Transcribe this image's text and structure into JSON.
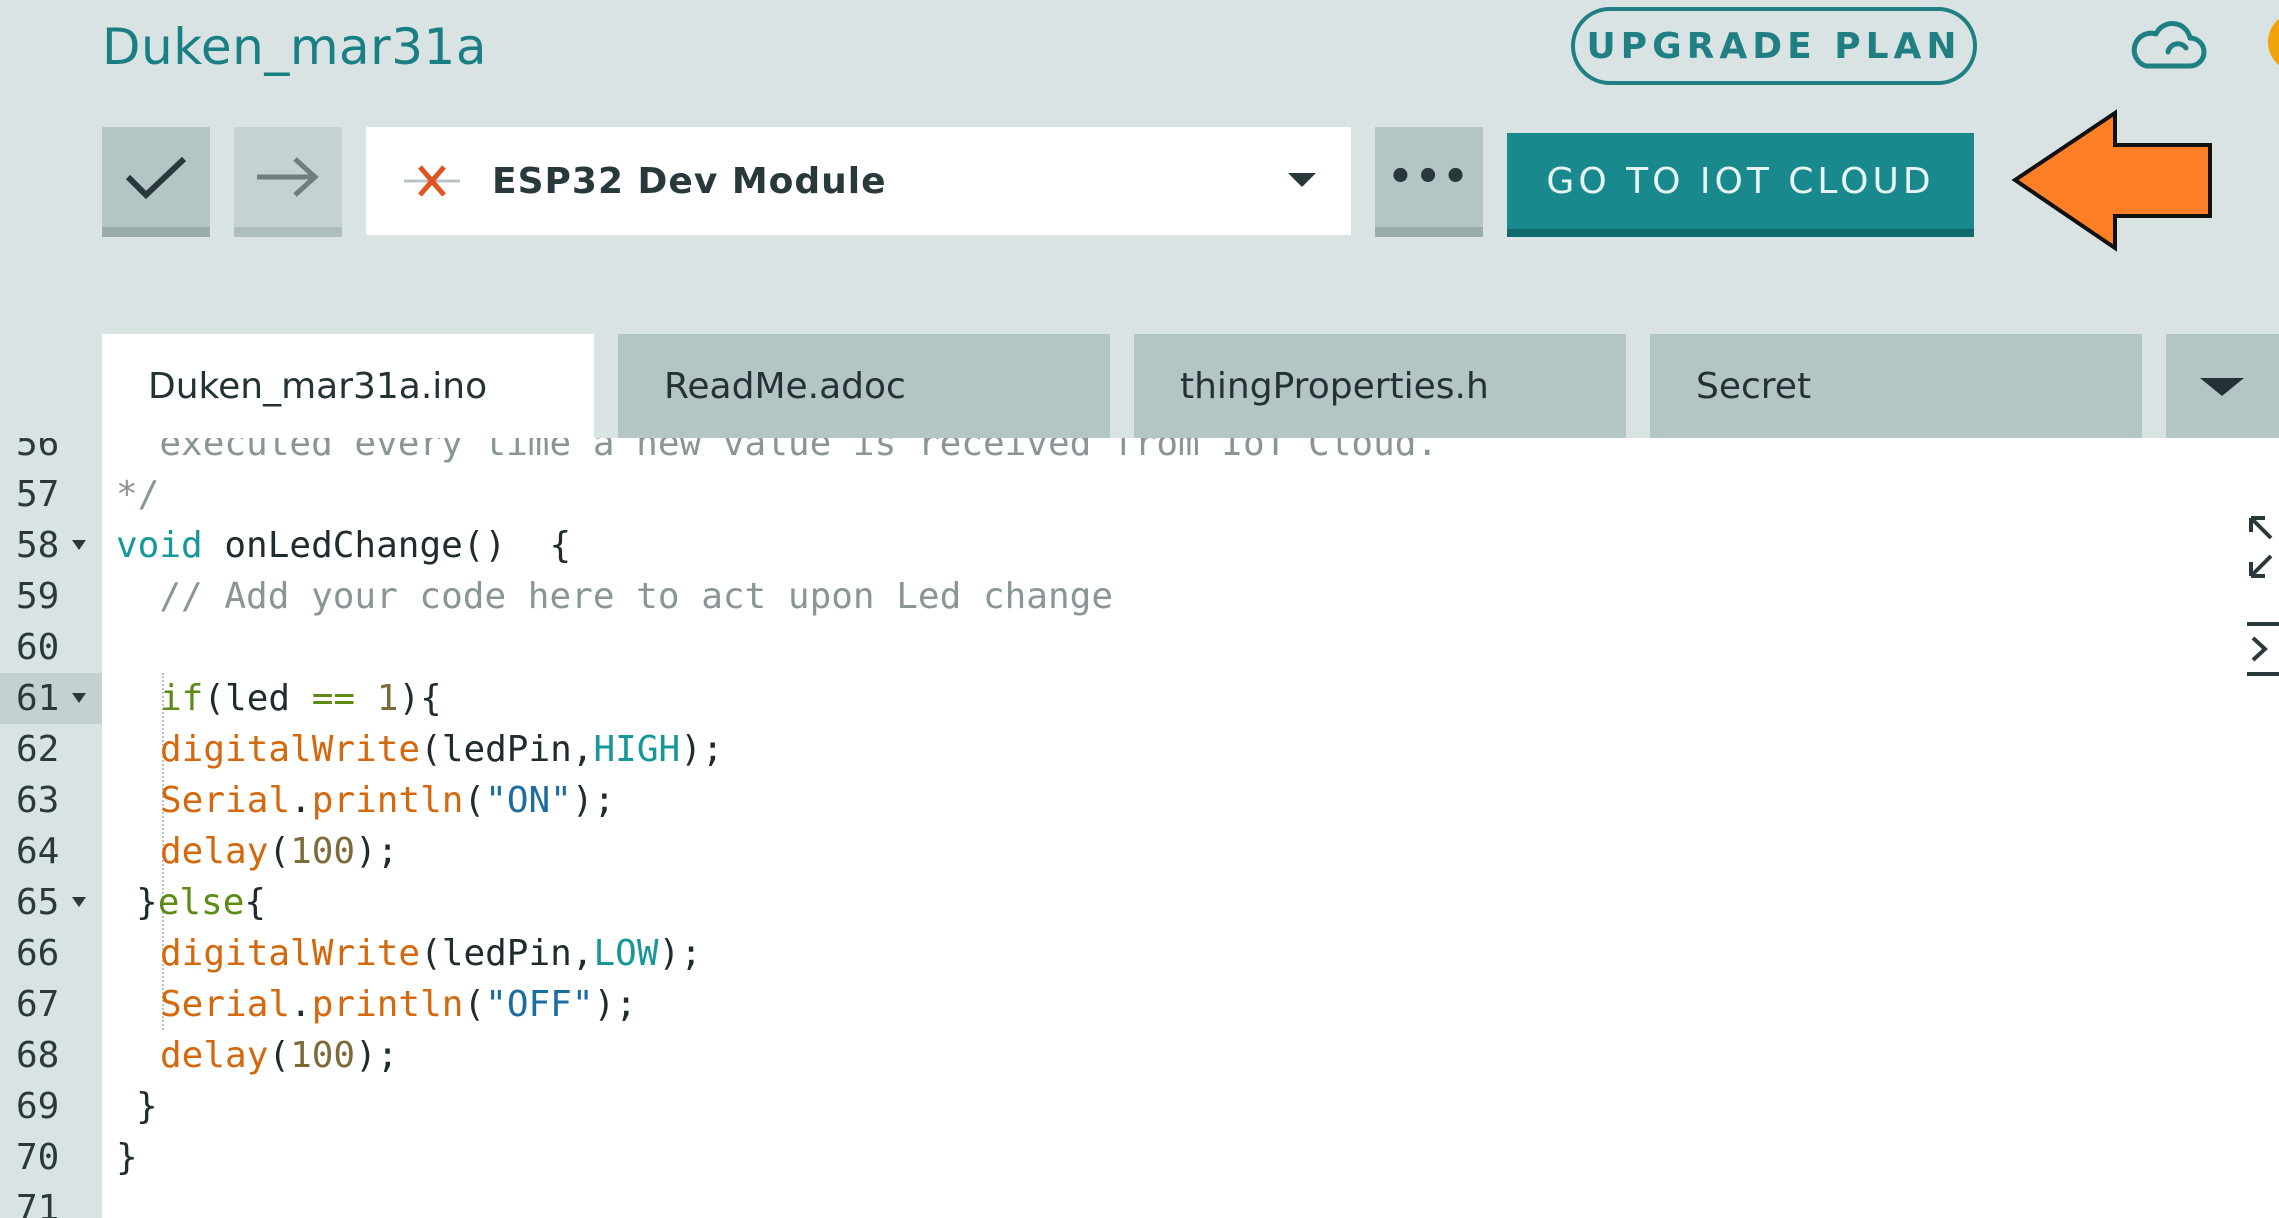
{
  "header": {
    "sketch_title": "Duken_mar31a",
    "upgrade_label": "UPGRADE PLAN"
  },
  "toolbar": {
    "board": "ESP32 Dev Module",
    "more_label": "•••",
    "iot_label": "GO TO IOT CLOUD"
  },
  "tabs": [
    {
      "label": "Duken_mar31a.ino",
      "active": true
    },
    {
      "label": "ReadMe.adoc",
      "active": false
    },
    {
      "label": "thingProperties.h",
      "active": false
    },
    {
      "label": "Secret",
      "active": false
    }
  ],
  "editor": {
    "active_line": 61,
    "line_numbers": [
      "56",
      "57",
      "58",
      "59",
      "60",
      "61",
      "62",
      "63",
      "64",
      "65",
      "66",
      "67",
      "68",
      "69",
      "70",
      "71"
    ],
    "code": {
      "l56": "  executed every time a new value is received from IoT Cloud.",
      "l57": "*/",
      "l58_kw": "void",
      "l58_rest": " onLedChange()  {",
      "l59": "  // Add your code here to act upon Led change",
      "l61_kw": "if",
      "l61_a": "(led ",
      "l61_op": "==",
      "l61_b": " ",
      "l61_num": "1",
      "l61_c": "){",
      "fn_digitalWrite": "digitalWrite",
      "arg_ledPin_open": "(ledPin,",
      "cst_high": "HIGH",
      "cst_low": "LOW",
      "close_paren_semi": ");",
      "fn_serial": "Serial",
      "dot": ".",
      "fn_println": "println",
      "open_paren": "(",
      "str_on": "\"ON\"",
      "str_off": "\"OFF\"",
      "fn_delay": "delay",
      "num_100": "100",
      "l65_brace": "}",
      "l65_kw": "else",
      "l65_open": "{",
      "l69": "}",
      "l70": "}"
    }
  },
  "colors": {
    "accent": "#1a898e",
    "annotation_arrow": "#ff7f27"
  }
}
